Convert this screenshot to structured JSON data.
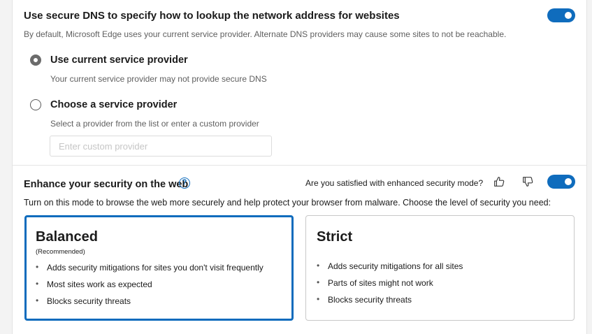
{
  "dns": {
    "title": "Use secure DNS to specify how to lookup the network address for websites",
    "description": "By default, Microsoft Edge uses your current service provider. Alternate DNS providers may cause some sites to not be reachable.",
    "toggle_on": true,
    "options": [
      {
        "label": "Use current service provider",
        "description": "Your current service provider may not provide secure DNS",
        "selected": true
      },
      {
        "label": "Choose a service provider",
        "description": "Select a provider from the list or enter a custom provider",
        "selected": false
      }
    ],
    "custom_provider": {
      "placeholder": "Enter custom provider",
      "value": ""
    }
  },
  "security": {
    "title": "Enhance your security on the web",
    "help_icon": "question-circle",
    "feedback_prompt": "Are you satisfied with enhanced security mode?",
    "toggle_on": true,
    "description": "Turn on this mode to browse the web more securely and help protect your browser from malware. Choose the level of security you need:",
    "levels": [
      {
        "title": "Balanced",
        "subtitle": "(Recommended)",
        "selected": true,
        "bullets": [
          "Adds security mitigations for sites you don't visit frequently",
          "Most sites work as expected",
          "Blocks security threats"
        ]
      },
      {
        "title": "Strict",
        "subtitle": "",
        "selected": false,
        "bullets": [
          "Adds security mitigations for all sites",
          "Parts of sites might not work",
          "Blocks security threats"
        ]
      }
    ]
  },
  "colors": {
    "accent": "#0f6cbd",
    "background": "#f3f3f3",
    "panel": "#ffffff"
  }
}
